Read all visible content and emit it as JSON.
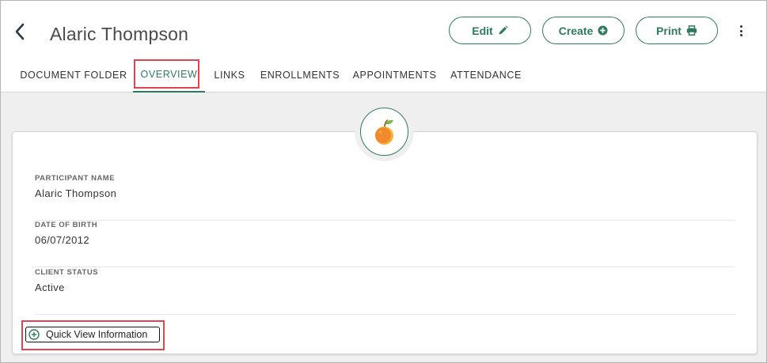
{
  "header": {
    "back_icon": "chevron-left-icon",
    "title": "Alaric Thompson",
    "actions": {
      "edit_label": "Edit",
      "edit_icon": "pencil-icon",
      "create_label": "Create",
      "create_icon": "plus-circle-icon",
      "print_label": "Print",
      "print_icon": "printer-icon",
      "more_icon": "kebab-menu-icon"
    }
  },
  "tabs": [
    {
      "label": "DOCUMENT FOLDER",
      "active": false
    },
    {
      "label": "OVERVIEW",
      "active": true
    },
    {
      "label": "LINKS",
      "active": false
    },
    {
      "label": "ENROLLMENTS",
      "active": false
    },
    {
      "label": "APPOINTMENTS",
      "active": false
    },
    {
      "label": "ATTENDANCE",
      "active": false
    }
  ],
  "overview": {
    "avatar_icon": "orange-fruit-icon",
    "fields": [
      {
        "label": "PARTICIPANT NAME",
        "value": "Alaric Thompson"
      },
      {
        "label": "DATE OF BIRTH",
        "value": "06/07/2012"
      },
      {
        "label": "CLIENT STATUS",
        "value": "Active"
      }
    ],
    "quick_view_label": "Quick View Information",
    "quick_view_icon": "plus-circle-outline-icon"
  },
  "colors": {
    "accent": "#2e7a5f",
    "highlight": "#e0444f",
    "background": "#efefef"
  }
}
